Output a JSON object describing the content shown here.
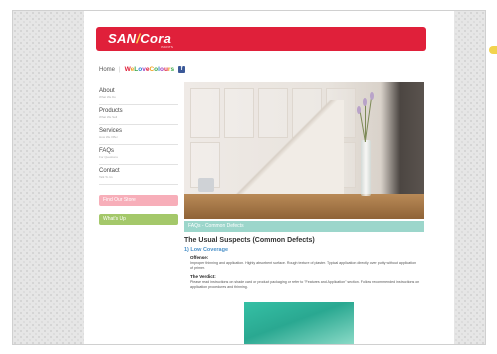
{
  "header": {
    "logo_main": "SAN",
    "logo_slash": "/",
    "logo_tail": "Cora",
    "logo_sub": "PAINTS"
  },
  "breadcrumb": {
    "home": "Home",
    "separator": "|",
    "welove": "WeLoveColours",
    "facebook_glyph": "f",
    "welove_colors": [
      "#e0203a",
      "#f0a020",
      "#3aa84a",
      "#2a7fd0",
      "#a040c0"
    ]
  },
  "sidebar": {
    "items": [
      {
        "title": "About",
        "sub": "What We Do"
      },
      {
        "title": "Products",
        "sub": "What We Sell"
      },
      {
        "title": "Services",
        "sub": "How We Offer"
      },
      {
        "title": "FAQs",
        "sub": "For Questions"
      },
      {
        "title": "Contact",
        "sub": "Talk To Us"
      }
    ],
    "find_store": "Find Our Store",
    "whats_up": "What's Up"
  },
  "content": {
    "section_bar": "FAQs - Common Defects",
    "title": "The Usual Suspects (Common Defects)",
    "item_title": "1) Low Coverage",
    "offense_label": "Offense:",
    "offense_text": "Improper thinning and application. Highly absorbent surface. Rough texture of plaster. Typical application directly over putty without application of primer.",
    "verdict_label": "The Verdict:",
    "verdict_text": "Please read instructions on shade card or product packaging or refer to \"Features and Application\" section. Follow recommended instructions on application procedures and thinning."
  },
  "colors": {
    "header_red": "#e0203a",
    "section_teal": "#9cd6cb",
    "store_pink": "#f7aeb9",
    "whatsup_green": "#a4c86a",
    "link_blue": "#4a90c8"
  }
}
